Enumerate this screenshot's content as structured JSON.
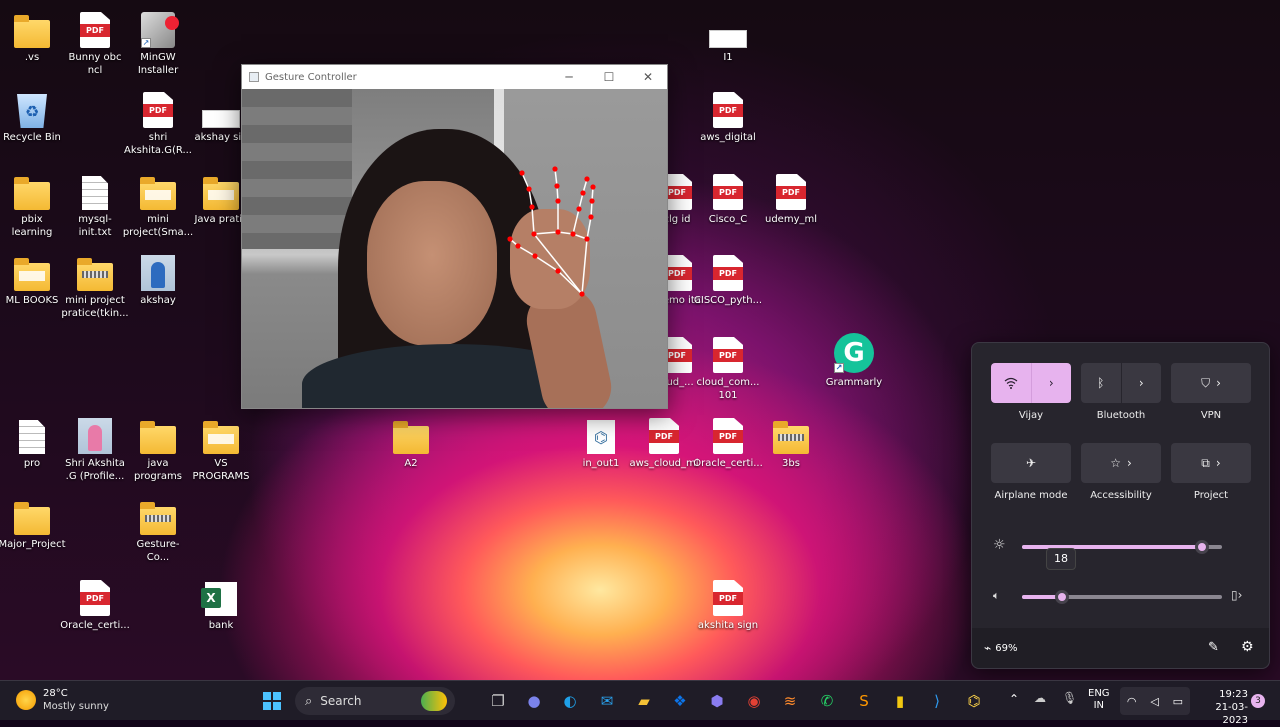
{
  "desktop": {
    "icons": [
      {
        "label": ".vs"
      },
      {
        "label": "Bunny obc ncl"
      },
      {
        "label": "MinGW Installer"
      },
      {
        "label": "I1"
      },
      {
        "label": "Recycle Bin"
      },
      {
        "label": "shri Akshita.G(R..."
      },
      {
        "label": "akshay sig"
      },
      {
        "label": "aws_digital"
      },
      {
        "label": "pbix learning"
      },
      {
        "label": "mysql-init.txt"
      },
      {
        "label": "mini project(Sma..."
      },
      {
        "label": "Java pratic"
      },
      {
        "label": "clg id"
      },
      {
        "label": "Cisco_C"
      },
      {
        "label": "udemy_ml"
      },
      {
        "label": "ML BOOKS"
      },
      {
        "label": "mini project pratice(tkin..."
      },
      {
        "label": "akshay"
      },
      {
        "label": "memo ita"
      },
      {
        "label": "CISCO_pyth..."
      },
      {
        "label": "oud_..."
      },
      {
        "label": "cloud_com... 101"
      },
      {
        "label": "Grammarly"
      },
      {
        "label": "pro"
      },
      {
        "label": "Shri Akshita .G (Profile..."
      },
      {
        "label": "java programs"
      },
      {
        "label": "VS PROGRAMS"
      },
      {
        "label": "A2"
      },
      {
        "label": "in_out1"
      },
      {
        "label": "aws_cloud_ml"
      },
      {
        "label": "Oracle_certi..."
      },
      {
        "label": "3bs"
      },
      {
        "label": "Major_Project"
      },
      {
        "label": "Gesture-Co..."
      },
      {
        "label": "Oracle_certi..."
      },
      {
        "label": "bank"
      },
      {
        "label": "akshita sign"
      }
    ],
    "pdf_badge": "PDF",
    "xls_badge": "X"
  },
  "gesture_window": {
    "title": "Gesture Controller",
    "min_glyph": "─",
    "max_glyph": "☐",
    "close_glyph": "✕",
    "landmark_color": "#ff0000",
    "connector_color": "#ffffff"
  },
  "quick_settings": {
    "tiles": [
      {
        "label": "Vijay",
        "icon": "wifi-icon",
        "active": true
      },
      {
        "label": "Bluetooth",
        "icon": "bluetooth-icon",
        "active": false
      },
      {
        "label": "VPN",
        "icon": "vpn-shield-icon",
        "active": false
      },
      {
        "label": "Airplane mode",
        "icon": "airplane-icon",
        "active": false
      },
      {
        "label": "Accessibility",
        "icon": "accessibility-icon",
        "active": false
      },
      {
        "label": "Project",
        "icon": "project-icon",
        "active": false
      }
    ],
    "brightness": {
      "tooltip": "18",
      "fraction": 0.9
    },
    "volume": {
      "fraction": 0.2
    },
    "battery_text": "69%",
    "accent": "#e7b3ee"
  },
  "taskbar": {
    "weather_temp": "28°C",
    "weather_desc": "Mostly sunny",
    "search_label": "Search",
    "lang_line1": "ENG",
    "lang_line2": "IN",
    "time": "19:23",
    "date": "21-03-2023",
    "notif_count": "3",
    "apps": [
      "widgets-icon",
      "task-view-icon",
      "teams-chat-icon",
      "edge-icon",
      "mail-icon",
      "file-explorer-icon",
      "dropbox-icon",
      "copilot-icon",
      "chrome-icon",
      "sublime-merge-icon",
      "whatsapp-icon",
      "sublime-text-icon",
      "power-bi-icon",
      "vscode-icon",
      "python-app-icon"
    ]
  }
}
